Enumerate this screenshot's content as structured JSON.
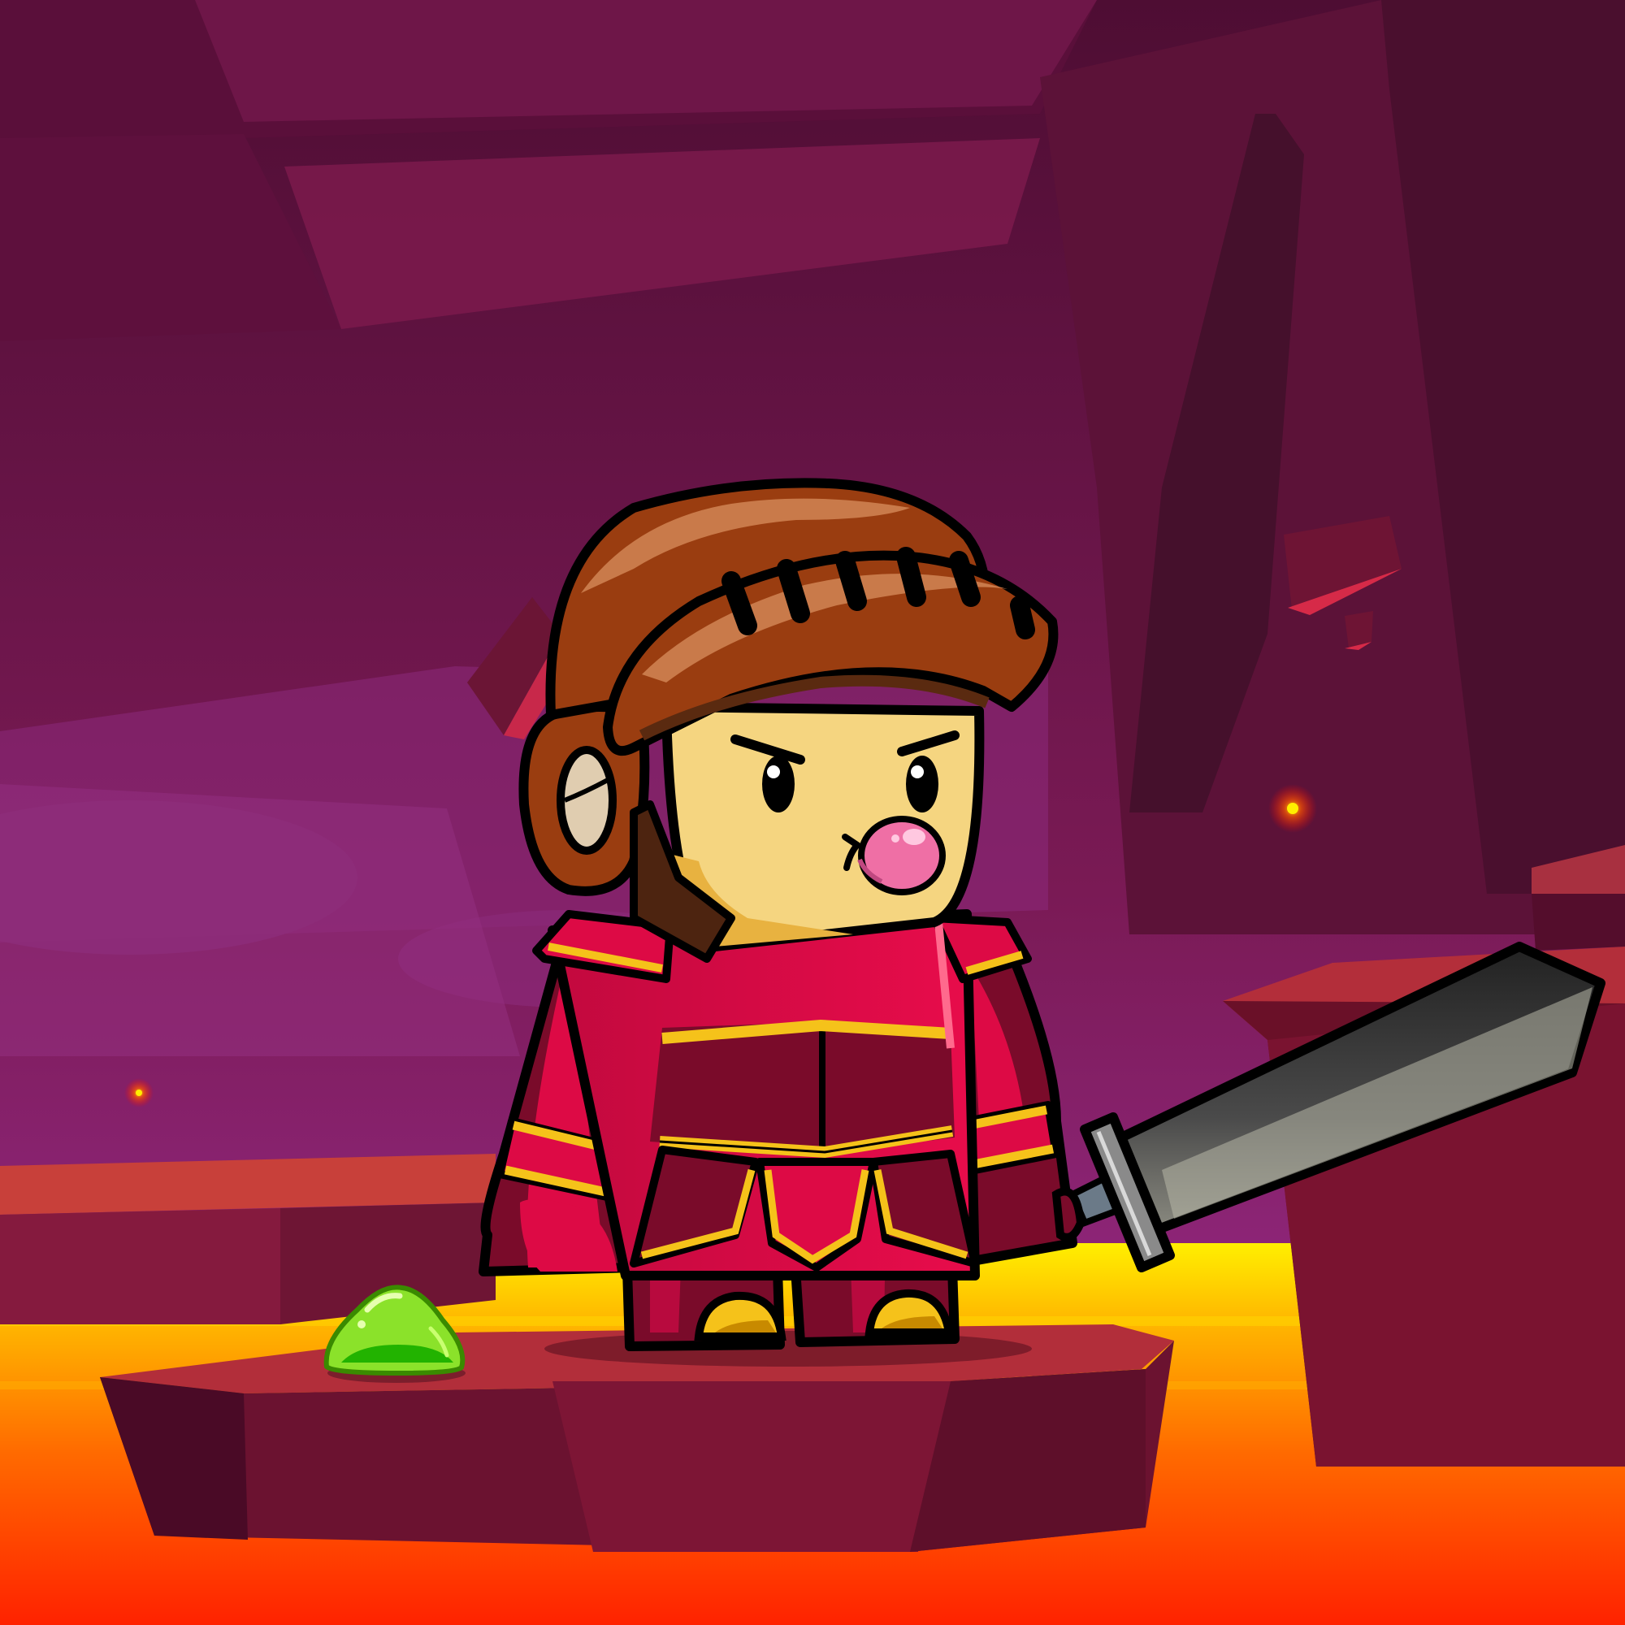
{
  "scene": {
    "setting": "volcanic-cave",
    "colors": {
      "sky_top": "#4e0d33",
      "sky_mid": "#7a1a55",
      "sky_bottom": "#9b2e94",
      "rock_dark": "#4a0f2a",
      "rock_mid": "#6b1030",
      "rock_top": "#b83236",
      "lava_top": "#ffeb00",
      "lava_mid": "#ff8a00",
      "lava_bottom": "#ff2a00",
      "armor": "#dd0a45",
      "armor_dark": "#7a0b2a",
      "armor_trim": "#f5c21a",
      "helmet": "#9a3d10",
      "helmet_light": "#c97a4a",
      "skin": "#f5d580",
      "gum": "#ef6fa5",
      "slime": "#8be22a",
      "blade": "#3d3d3d"
    }
  },
  "characters": [
    {
      "name": "knight",
      "role": "player",
      "holding": "greatsword",
      "expression": "angry-blowing-bubblegum"
    },
    {
      "name": "slime",
      "role": "enemy",
      "color": "green"
    }
  ],
  "props": [
    "floating-rock-shards",
    "ember-sparks",
    "lava-pool",
    "stone-platforms"
  ]
}
